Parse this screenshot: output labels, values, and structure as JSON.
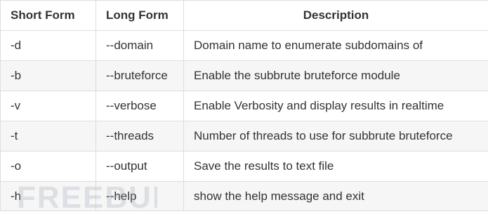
{
  "table": {
    "headers": [
      "Short Form",
      "Long Form",
      "Description"
    ],
    "rows": [
      [
        "-d",
        "--domain",
        "Domain name to enumerate subdomains of"
      ],
      [
        "-b",
        "--bruteforce",
        "Enable the subbrute bruteforce module"
      ],
      [
        "-v",
        "--verbose",
        "Enable Verbosity and display results in realtime"
      ],
      [
        "-t",
        "--threads",
        "Number of threads to use for subbrute bruteforce"
      ],
      [
        "-o",
        "--output",
        "Save the results to text file"
      ],
      [
        "-h",
        "--help",
        "show the help message and exit"
      ]
    ]
  },
  "watermark": {
    "text": "FREEBUF",
    "color": "#9aa7b4"
  }
}
